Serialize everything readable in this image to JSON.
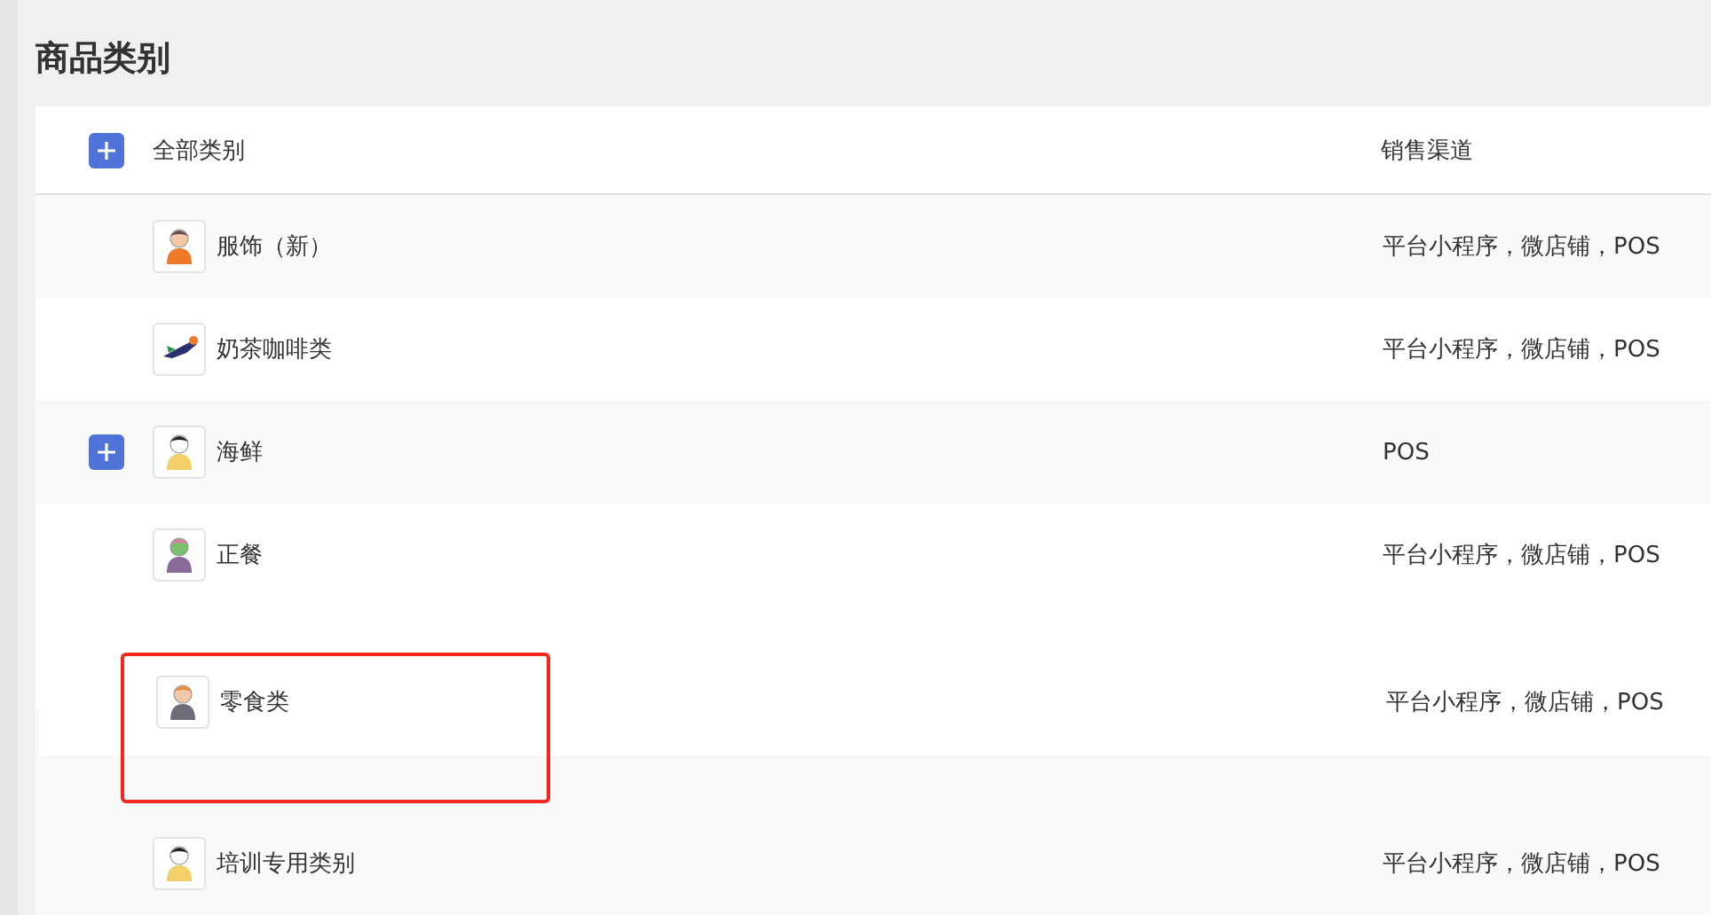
{
  "page": {
    "title": "商品类别"
  },
  "table": {
    "header": {
      "expandable": true,
      "name_label": "全部类别",
      "channel_label": "销售渠道"
    },
    "rows": [
      {
        "kind": "row",
        "name": "服饰（新）",
        "channels": "平台小程序，微店铺，POS",
        "avatar": {
          "kind": "orange"
        },
        "expandable": false
      },
      {
        "kind": "row",
        "name": "奶茶咖啡类",
        "channels": "平台小程序，微店铺，POS",
        "avatar": {
          "kind": "bird"
        },
        "expandable": false
      },
      {
        "kind": "row",
        "name": "海鲜",
        "channels": "POS",
        "avatar": {
          "kind": "yellow"
        },
        "expandable": true
      },
      {
        "kind": "row",
        "name": "正餐",
        "channels": "平台小程序，微店铺，POS",
        "avatar": {
          "kind": "green"
        },
        "expandable": false
      },
      {
        "kind": "placeholder"
      },
      {
        "kind": "covered"
      },
      {
        "kind": "row",
        "name": "培训专用类别",
        "channels": "平台小程序，微店铺，POS",
        "avatar": {
          "kind": "yellow"
        },
        "expandable": false
      }
    ],
    "dragged_row": {
      "name": "零食类",
      "channels": "平台小程序，微店铺，POS",
      "avatar": {
        "kind": "gray"
      },
      "highlighted": true
    }
  }
}
